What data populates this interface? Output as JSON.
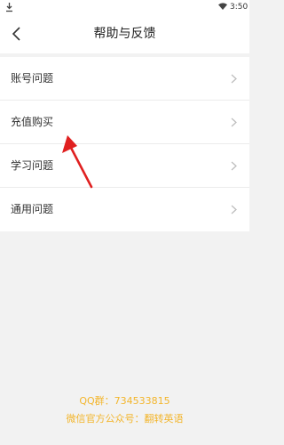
{
  "status_bar": {
    "time": "3:50"
  },
  "header": {
    "title": "帮助与反馈"
  },
  "menu": {
    "items": [
      {
        "label": "账号问题"
      },
      {
        "label": "充值购买"
      },
      {
        "label": "学习问题"
      },
      {
        "label": "通用问题"
      }
    ]
  },
  "footer": {
    "qq": "QQ群：734533815",
    "wechat": "微信官方公众号：翻转英语"
  },
  "colors": {
    "accent": "#f3b52b",
    "annotation_arrow": "#e02020",
    "background": "#f2f2f2"
  },
  "icons": {
    "download": "download-icon",
    "wifi": "wifi-icon",
    "back": "back-chevron-icon",
    "chevron": "chevron-right-icon"
  }
}
